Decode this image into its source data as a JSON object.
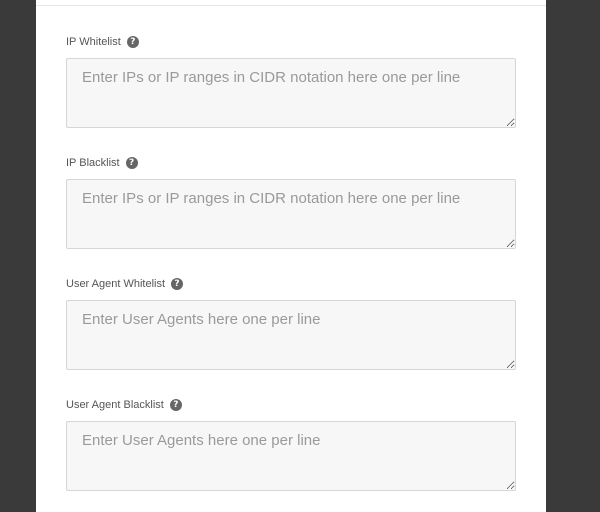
{
  "help_icon_glyph": "?",
  "fields": [
    {
      "label": "IP Whitelist",
      "value": "",
      "placeholder": "Enter IPs or IP ranges in CIDR notation here one per line"
    },
    {
      "label": "IP Blacklist",
      "value": "",
      "placeholder": "Enter IPs or IP ranges in CIDR notation here one per line"
    },
    {
      "label": "User Agent Whitelist",
      "value": "",
      "placeholder": "Enter User Agents here one per line"
    },
    {
      "label": "User Agent Blacklist",
      "value": "",
      "placeholder": "Enter User Agents here one per line"
    }
  ]
}
